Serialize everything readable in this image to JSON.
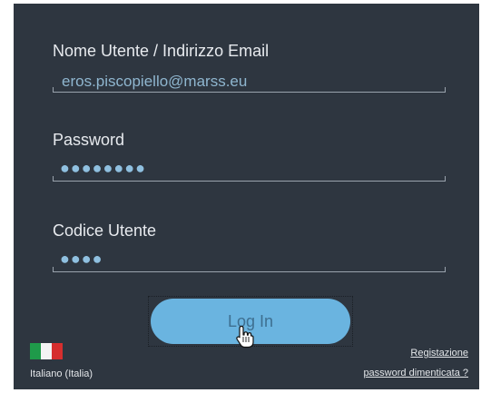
{
  "form": {
    "username": {
      "label": "Nome Utente / Indirizzo Email",
      "value": "eros.piscopiello@marss.eu"
    },
    "password": {
      "label": "Password",
      "masked_value": "●●●●●●●●"
    },
    "user_code": {
      "label": "Codice Utente",
      "masked_value": "●●●●"
    },
    "login_label": "Log In"
  },
  "footer": {
    "language_label": "Italiano (Italia)",
    "register_link": "Registazione",
    "forgot_password_link": "password dimenticata ?"
  },
  "colors": {
    "panel_bg": "#2e3640",
    "button_bg": "#6ab4e0",
    "flag_green": "#1f9a4a",
    "flag_white": "#f4f4f4",
    "flag_red": "#d62e2e"
  },
  "icons": {
    "cursor": "hand-pointer-icon",
    "flag": "italy-flag-icon"
  }
}
